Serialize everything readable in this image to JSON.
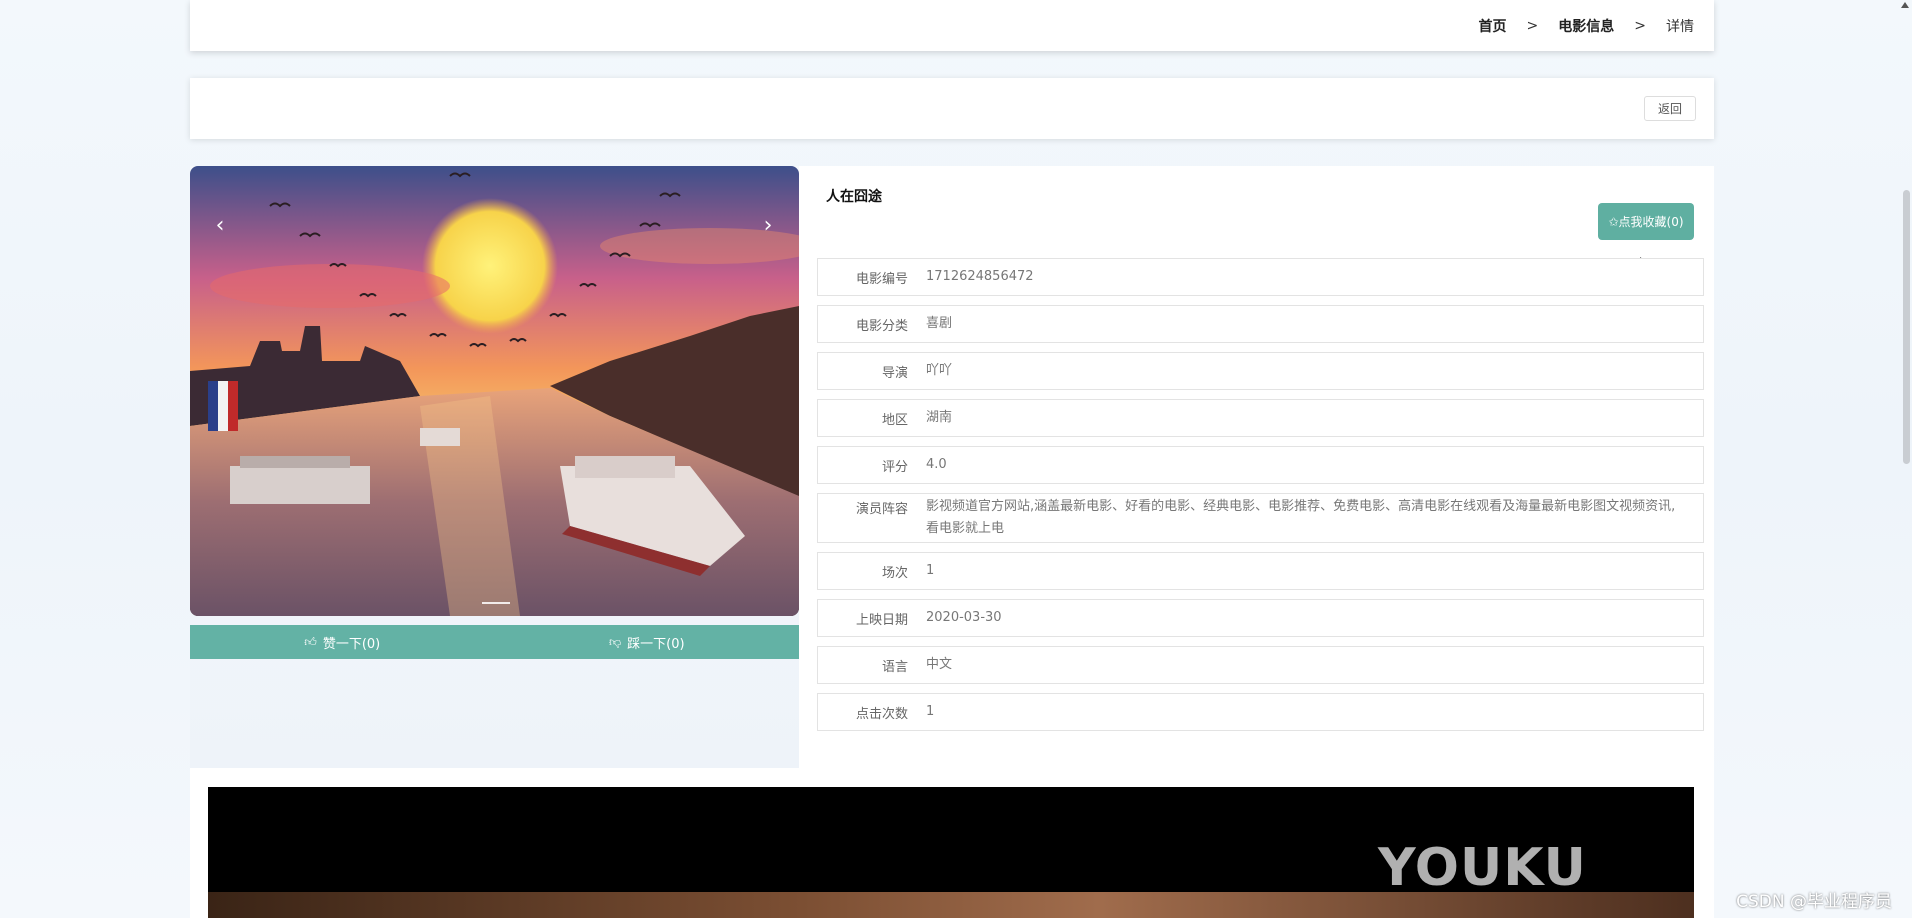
{
  "breadcrumb": {
    "home": "首页",
    "sep1": ">",
    "section": "电影信息",
    "sep2": ">",
    "current": "详情"
  },
  "actions": {
    "back_label": "返回"
  },
  "movie": {
    "title": "人在囧途",
    "favorite_label": "✩点我收藏(0)",
    "like_label": "赞一下(0)",
    "dislike_label": "踩一下(0)",
    "fields": [
      {
        "label": "电影编号",
        "value": "1712624856472"
      },
      {
        "label": "电影分类",
        "value": "喜剧"
      },
      {
        "label": "导演",
        "value": "吖吖"
      },
      {
        "label": "地区",
        "value": "湖南"
      },
      {
        "label": "评分",
        "value": "4.0"
      },
      {
        "label": "演员阵容",
        "value": "影视频道官方网站,涵盖最新电影、好看的电影、经典电影、电影推荐、免费电影、高清电影在线观看及海量最新电影图文视频资讯,看电影就上电"
      },
      {
        "label": "场次",
        "value": "1"
      },
      {
        "label": "上映日期",
        "value": "2020-03-30"
      },
      {
        "label": "语言",
        "value": "中文"
      },
      {
        "label": "点击次数",
        "value": "1"
      }
    ]
  },
  "carousel": {
    "prev_icon": "chevron-left-icon",
    "next_icon": "chevron-right-icon",
    "prev_glyph": "‹",
    "next_glyph": "›"
  },
  "video": {
    "logo_text": "YOUKU"
  },
  "watermark": "CSDN @毕业程序员",
  "colors": {
    "accent": "#5fafa1",
    "vote_bar": "#63b2a5"
  }
}
